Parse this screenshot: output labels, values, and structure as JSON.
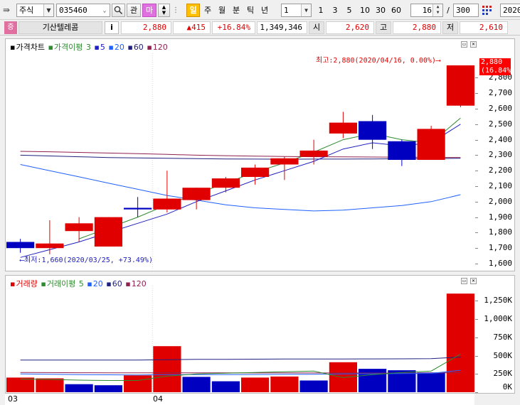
{
  "toolbar": {
    "market_type": "주식",
    "stock_code": "035460",
    "watch_label": "관",
    "my_label": "마",
    "period_buttons": [
      "일",
      "주",
      "월",
      "분",
      "틱",
      "년"
    ],
    "interval_value": "1",
    "interval_buttons": [
      "1",
      "3",
      "5",
      "10",
      "30",
      "60"
    ],
    "view_count": "16",
    "separator": "/",
    "total_count": "300",
    "date_value": "2020"
  },
  "quote": {
    "market_icon": "증",
    "name": "기산텔레콤",
    "info_label": "i",
    "price": "2,880",
    "change": "▲415",
    "change_rate": "+16.84%",
    "volume": "1,349,346",
    "open_label": "시",
    "open": "2,620",
    "high_label": "고",
    "high": "2,880",
    "low_label": "저",
    "low": "2,610"
  },
  "price_chart": {
    "legend": [
      {
        "text": "가격차트",
        "color": "#000000"
      },
      {
        "text": "가격이평",
        "color": "#2e8b2e"
      },
      {
        "text": "3",
        "color": "#2e8b2e"
      },
      {
        "text": "5",
        "color": "#2020c0"
      },
      {
        "text": "20",
        "color": "#2060ff"
      },
      {
        "text": "60",
        "color": "#202080"
      },
      {
        "text": "120",
        "color": "#902050"
      }
    ],
    "annotation_high": "최고:2,880(2020/04/16, 0.00%)⟶",
    "annotation_low": "⟵최저:1,660(2020/03/25, +73.49%)",
    "current_price_label": "2,880",
    "current_rate_label": "(16.84%)",
    "y_ticks": [
      "2,800",
      "2,700",
      "2,600",
      "2,500",
      "2,400",
      "2,300",
      "2,200",
      "2,100",
      "2,000",
      "1,900",
      "1,800",
      "1,700",
      "1,600"
    ]
  },
  "volume_chart": {
    "legend": [
      {
        "text": "거래량",
        "color": "#e00000"
      },
      {
        "text": "거래이평",
        "color": "#2e8b2e"
      },
      {
        "text": "5",
        "color": "#2e8b2e"
      },
      {
        "text": "20",
        "color": "#2060ff"
      },
      {
        "text": "60",
        "color": "#202080"
      },
      {
        "text": "120",
        "color": "#902050"
      }
    ],
    "y_ticks": [
      "1,250K",
      "1,000K",
      "750K",
      "500K",
      "250K",
      "0K"
    ],
    "x_ticks": [
      "03",
      "04"
    ]
  },
  "chart_data": {
    "type": "candlestick",
    "ylim": [
      1600,
      2880
    ],
    "candles": [
      {
        "open": 1740,
        "close": 1700,
        "high": 1760,
        "low": 1670
      },
      {
        "open": 1700,
        "close": 1730,
        "high": 1880,
        "low": 1660
      },
      {
        "open": 1810,
        "close": 1860,
        "high": 1900,
        "low": 1740
      },
      {
        "open": 1710,
        "close": 1900,
        "high": 1900,
        "low": 1710
      },
      {
        "open": 1960,
        "close": 1950,
        "high": 2030,
        "low": 1900
      },
      {
        "open": 1950,
        "close": 2020,
        "high": 2200,
        "low": 1930
      },
      {
        "open": 2010,
        "close": 2090,
        "high": 2090,
        "low": 1950
      },
      {
        "open": 2090,
        "close": 2150,
        "high": 2160,
        "low": 2060
      },
      {
        "open": 2160,
        "close": 2220,
        "high": 2240,
        "low": 2110
      },
      {
        "open": 2240,
        "close": 2280,
        "high": 2290,
        "low": 2140
      },
      {
        "open": 2290,
        "close": 2330,
        "high": 2400,
        "low": 2240
      },
      {
        "open": 2440,
        "close": 2510,
        "high": 2580,
        "low": 2410
      },
      {
        "open": 2520,
        "close": 2400,
        "high": 2560,
        "low": 2340
      },
      {
        "open": 2390,
        "close": 2270,
        "high": 2400,
        "low": 2230
      },
      {
        "open": 2270,
        "close": 2470,
        "high": 2490,
        "low": 2270
      },
      {
        "open": 2620,
        "close": 2880,
        "high": 2880,
        "low": 2610
      }
    ],
    "ma_price": {
      "ma3": [
        null,
        null,
        1760,
        1830,
        1900,
        1980,
        2050,
        2120,
        2190,
        2250,
        2320,
        2400,
        2440,
        2400,
        2380,
        2540
      ],
      "ma5": [
        1640,
        1690,
        1740,
        1800,
        1860,
        1920,
        2000,
        2070,
        2140,
        2200,
        2260,
        2340,
        2380,
        2360,
        2380,
        2500
      ],
      "ma20": [
        2240,
        2200,
        2160,
        2120,
        2080,
        2040,
        2010,
        1980,
        1960,
        1950,
        1940,
        1945,
        1960,
        1975,
        2000,
        2045
      ],
      "ma60": [
        2300,
        2295,
        2290,
        2285,
        2282,
        2280,
        2278,
        2276,
        2275,
        2274,
        2275,
        2275,
        2276,
        2277,
        2278,
        2280
      ],
      "ma120": [
        2325,
        2322,
        2318,
        2314,
        2310,
        2305,
        2300,
        2297,
        2294,
        2292,
        2290,
        2289,
        2288,
        2287,
        2286,
        2285
      ]
    },
    "volume_ylim": [
      0,
      1400
    ],
    "volume": [
      200,
      190,
      110,
      95,
      230,
      630,
      210,
      150,
      200,
      215,
      160,
      410,
      320,
      300,
      270,
      1349
    ],
    "volume_up": [
      true,
      true,
      false,
      false,
      true,
      true,
      false,
      false,
      true,
      true,
      false,
      true,
      false,
      false,
      false,
      true
    ],
    "ma_volume": {
      "ma5": [
        180,
        175,
        165,
        160,
        160,
        220,
        250,
        260,
        270,
        280,
        290,
        200,
        240,
        270,
        290,
        520
      ],
      "ma20": [
        250,
        245,
        240,
        238,
        236,
        240,
        240,
        240,
        242,
        244,
        246,
        250,
        252,
        255,
        258,
        300
      ],
      "ma60": [
        440,
        440,
        440,
        440,
        440,
        445,
        450,
        450,
        452,
        454,
        455,
        455,
        456,
        457,
        460,
        480
      ],
      "ma120": [
        270,
        268,
        266,
        265,
        264,
        264,
        264,
        264,
        263,
        263,
        263,
        263,
        262,
        262,
        262,
        270
      ]
    }
  },
  "colors": {
    "up": "#e00000",
    "down": "#0000c0",
    "ma3": "#2e8b2e",
    "ma5": "#2020c0",
    "ma20": "#2060ff",
    "ma60": "#202080",
    "ma120": "#902050"
  }
}
